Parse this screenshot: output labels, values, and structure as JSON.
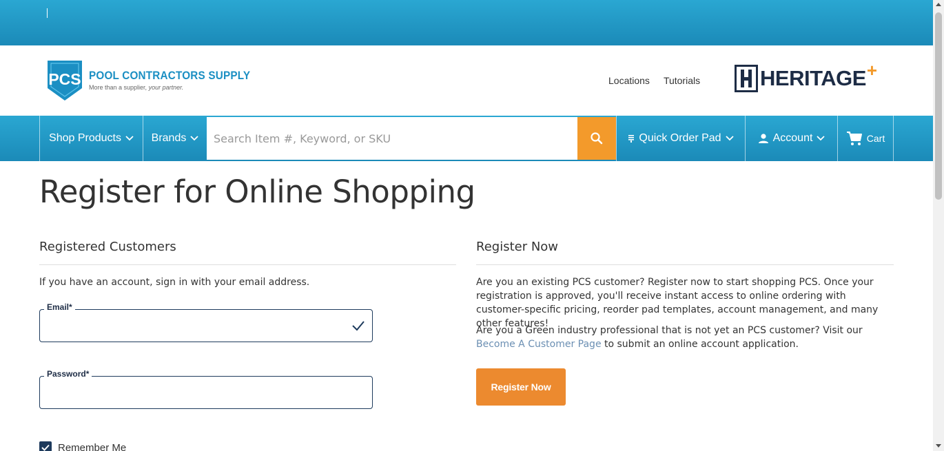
{
  "header": {
    "logo": {
      "name": "POOL CONTRACTORS SUPPLY",
      "tagline_prefix": "More than a supplier, ",
      "tagline_italic": "your partner.",
      "mark": "PCS"
    },
    "links": [
      "Locations",
      "Tutorials"
    ],
    "partner_logo": {
      "text": "HERITAGE",
      "plus": "+"
    }
  },
  "nav": {
    "shop_products": "Shop Products",
    "brands": "Brands",
    "search_placeholder": "Search Item #, Keyword, or SKU",
    "quick_order_pad": "Quick Order Pad",
    "account": "Account",
    "cart": "Cart"
  },
  "page": {
    "title": "Register for Online Shopping"
  },
  "login": {
    "heading": "Registered Customers",
    "intro": "If you have an account, sign in with your email address.",
    "email_label": "Email*",
    "email_value": "",
    "password_label": "Password*",
    "password_value": "",
    "remember_label": "Remember Me"
  },
  "register": {
    "heading": "Register Now",
    "paragraph1": "Are you an existing PCS customer? Register now to start shopping PCS. Once your registration is approved, you'll receive instant access to online ordering with customer-specific pricing, reorder pad templates, account management, and many other features!",
    "paragraph2_before": "Are you a Green industry professional that is not yet an PCS customer? Visit our ",
    "paragraph2_link": "Become A Customer Page",
    "paragraph2_after": " to submit an online account application.",
    "button_label": "Register Now"
  },
  "colors": {
    "brand_blue": "#1b8ab8",
    "accent_orange": "#f39a2b",
    "button_orange": "#ec8a2f",
    "navy": "#1d3a5c"
  }
}
